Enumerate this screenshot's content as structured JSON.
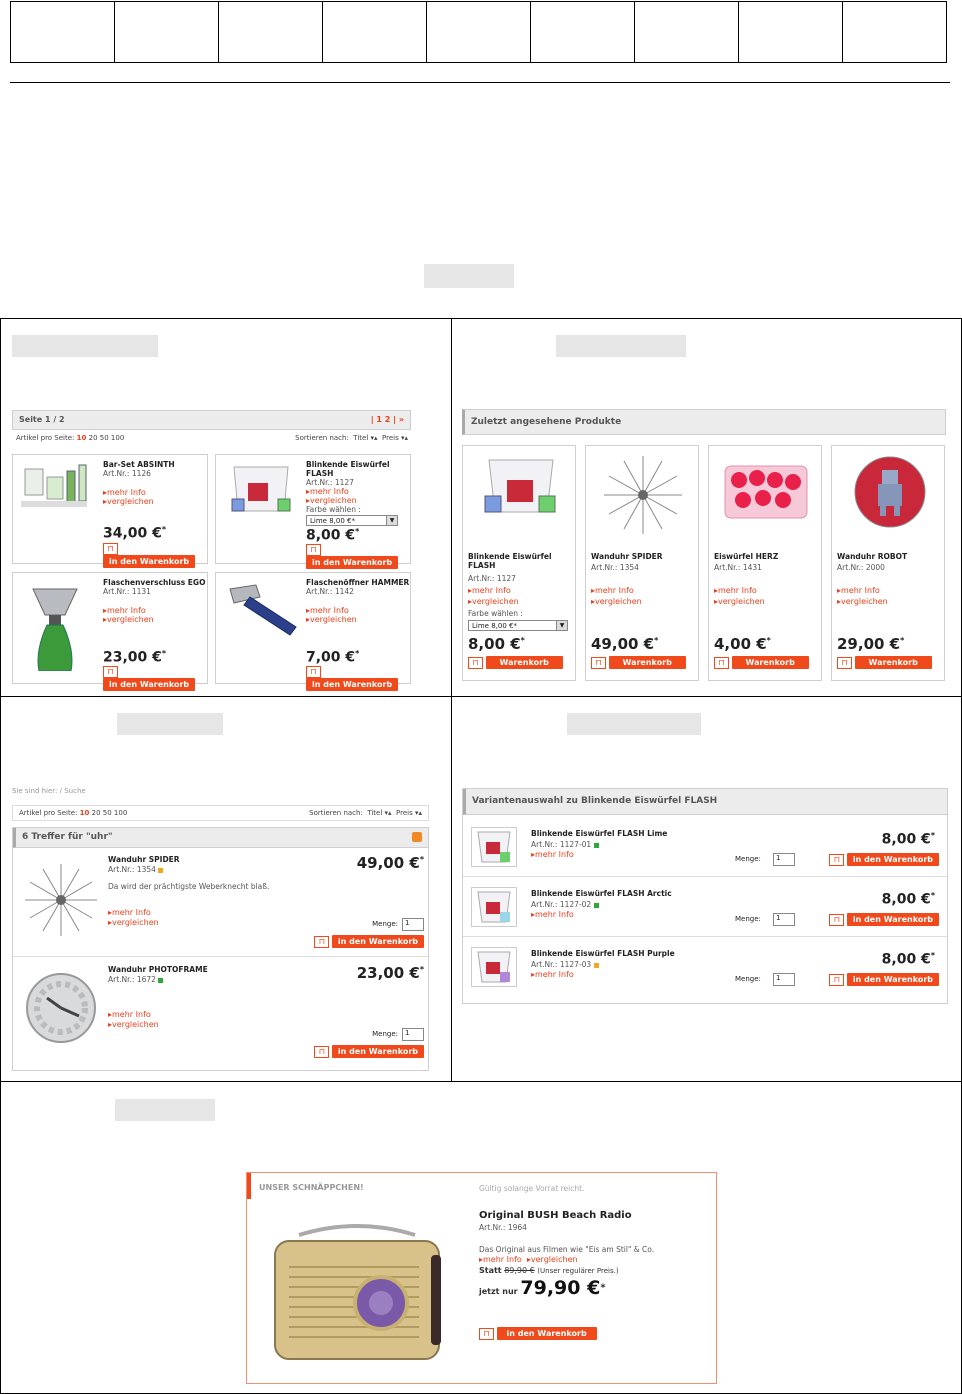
{
  "shop": {
    "page_label": "Seite 1 / 2",
    "pagination": "| 1 2 | »",
    "per_page_label": "Artikel pro Seite:",
    "per_page_active": "10",
    "per_page_options": "20  50  100",
    "sort_label": "Sortieren nach:",
    "sort_title": "Titel",
    "sort_price": "Preis",
    "art_nr": "Art.Nr.:",
    "more_info": "mehr Info",
    "compare": "vergleichen",
    "color_choose": "Farbe wählen :",
    "add_to_cart": "in den Warenkorb",
    "cart_short": "Warenkorb",
    "quantity": "Menge:",
    "qty_value": "1",
    "currency_mark": "*",
    "breadcrumb": "Sie sind hier: / Suche"
  },
  "grid_products": [
    {
      "name": "Bar-Set ABSINTH",
      "art": "1126",
      "price": "34,00 €"
    },
    {
      "name": "Blinkende Eiswürfel FLASH",
      "art": "1127",
      "price": "8,00 €",
      "select": "Lime 8,00 €*"
    },
    {
      "name": "Flaschenverschluss EGO",
      "art": "1131",
      "price": "23,00 €"
    },
    {
      "name": "Flaschenöffner HAMMER",
      "art": "1142",
      "price": "7,00 €"
    }
  ],
  "recent": {
    "title": "Zuletzt angesehene Produkte",
    "items": [
      {
        "name": "Blinkende Eiswürfel FLASH",
        "art": "1127",
        "price": "8,00 €",
        "select": "Lime 8,00 €*"
      },
      {
        "name": "Wanduhr SPIDER",
        "art": "1354",
        "price": "49,00 €"
      },
      {
        "name": "Eiswürfel HERZ",
        "art": "1431",
        "price": "4,00 €"
      },
      {
        "name": "Wanduhr ROBOT",
        "art": "2000",
        "price": "29,00 €"
      }
    ]
  },
  "search": {
    "hits_title": "6 Treffer für \"uhr\"",
    "items": [
      {
        "name": "Wanduhr SPIDER",
        "art": "1354",
        "desc": "Da wird der prächtigste Weberknecht blaß.",
        "price": "49,00 €"
      },
      {
        "name": "Wanduhr PHOTOFRAME",
        "art": "1672",
        "desc": "",
        "price": "23,00 €"
      }
    ]
  },
  "variants": {
    "title": "Variantenauswahl zu Blinkende Eiswürfel FLASH",
    "items": [
      {
        "name": "Blinkende Eiswürfel FLASH Lime",
        "art": "1127-01",
        "price": "8,00 €",
        "status_color": "#2fa83a"
      },
      {
        "name": "Blinkende Eiswürfel FLASH Arctic",
        "art": "1127-02",
        "price": "8,00 €",
        "status_color": "#2fa83a"
      },
      {
        "name": "Blinkende Eiswürfel FLASH Purple",
        "art": "1127-03",
        "price": "8,00 €",
        "status_color": "#f0a820"
      }
    ]
  },
  "deal": {
    "badge": "UNSER SCHNÄPPCHEN!",
    "validity": "Gültig solange Vorrat reicht.",
    "name": "Original BUSH Beach Radio",
    "art": "1964",
    "desc": "Das Original aus Filmen wie \"Eis am Stil\" & Co.",
    "statt_label": "Statt",
    "old_price": "89,90 €",
    "regular_note": "(Unser regulärer Preis.)",
    "now_label": "jetzt nur",
    "new_price": "79,90 €"
  },
  "colors": {
    "accent": "#f04a1c",
    "text_red": "#e8401c",
    "bar_bg": "#ececec"
  }
}
